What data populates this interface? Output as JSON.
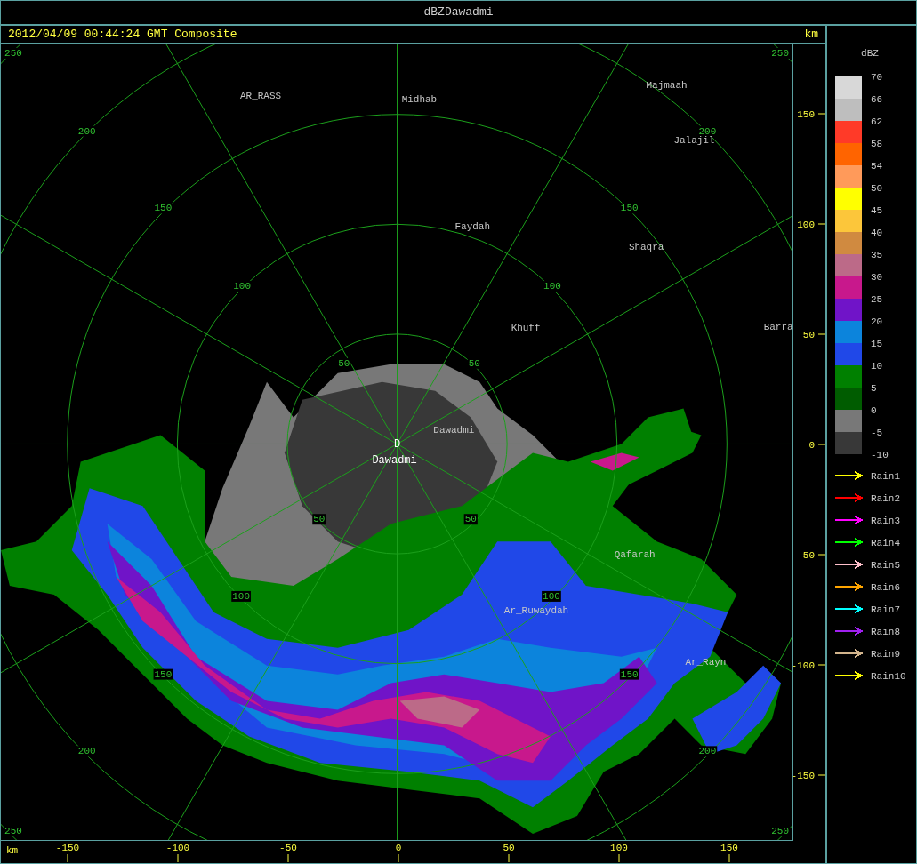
{
  "window": {
    "title": "dBZDawadmi"
  },
  "header": {
    "timestamp": "2012/04/09 00:44:24 GMT Composite",
    "unit": "km"
  },
  "radar_map": {
    "site_marker": "D",
    "site_label": "Dawadmi",
    "places": [
      "AR_RASS",
      "Midhab",
      "Majmaah",
      "Jalajil",
      "Faydah",
      "Shaqra",
      "Khuff",
      "Barra",
      "Dawadmi",
      "Qafarah",
      "Ar_Ruwaydah",
      "Ar_Rayn"
    ],
    "range_rings": [
      {
        "labels": [
          "50",
          "50",
          "50",
          "50"
        ]
      },
      {
        "labels": [
          "100",
          "100",
          "100",
          "100"
        ]
      },
      {
        "labels": [
          "150",
          "150",
          "150",
          "150"
        ]
      },
      {
        "labels": [
          "200",
          "200",
          "200",
          "200"
        ]
      },
      {
        "labels": [
          "250",
          "250",
          "250",
          "250"
        ]
      }
    ]
  },
  "y_axis": {
    "ticks": [
      "150",
      "100",
      "50",
      "0",
      "-50",
      "-100",
      "-150"
    ]
  },
  "x_axis": {
    "unit": "km",
    "ticks": [
      "-150",
      "-100",
      "-50",
      "0",
      "50",
      "100",
      "150"
    ]
  },
  "legend": {
    "title": "dBZ",
    "labels": [
      "70",
      "66",
      "62",
      "58",
      "54",
      "50",
      "45",
      "40",
      "35",
      "30",
      "25",
      "20",
      "15",
      "10",
      "5",
      "0",
      "-5",
      "-10"
    ],
    "bands": [
      {
        "color": "#d8d8d8"
      },
      {
        "color": "#bebebe"
      },
      {
        "color": "#ff3a28"
      },
      {
        "color": "#ff6400"
      },
      {
        "color": "#ff9a5a"
      },
      {
        "color": "#ffff00"
      },
      {
        "color": "#fcc63a"
      },
      {
        "color": "#d08a40"
      },
      {
        "color": "#bc6a88"
      },
      {
        "color": "#c8188c"
      },
      {
        "color": "#7014c8"
      },
      {
        "color": "#0c84dc"
      },
      {
        "color": "#2048e8"
      },
      {
        "color": "#008000"
      },
      {
        "color": "#005c00"
      },
      {
        "color": "#787878"
      },
      {
        "color": "#383838"
      }
    ],
    "tracks": [
      {
        "label": "Rain1",
        "color": "#ffff00"
      },
      {
        "label": "Rain2",
        "color": "#ff0000"
      },
      {
        "label": "Rain3",
        "color": "#ff00ff"
      },
      {
        "label": "Rain4",
        "color": "#00ff00"
      },
      {
        "label": "Rain5",
        "color": "#ffc0cb"
      },
      {
        "label": "Rain6",
        "color": "#ffa500"
      },
      {
        "label": "Rain7",
        "color": "#00ffff"
      },
      {
        "label": "Rain8",
        "color": "#a020f0"
      },
      {
        "label": "Rain9",
        "color": "#d2b48c"
      },
      {
        "label": "Rain10",
        "color": "#ffff01"
      }
    ]
  }
}
